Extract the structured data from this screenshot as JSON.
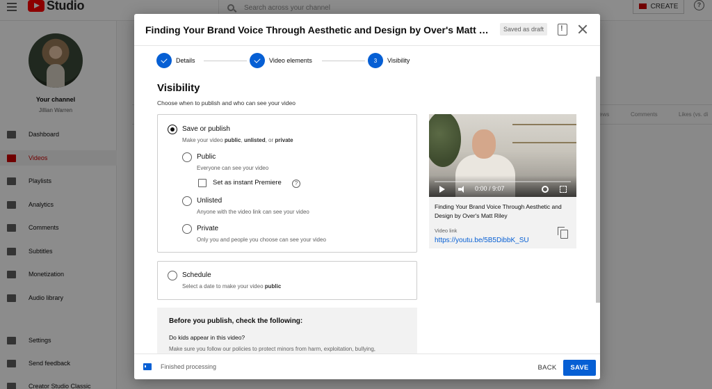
{
  "topbar": {
    "logo_text": "Studio",
    "search_placeholder": "Search across your channel",
    "create_label": "CREATE",
    "help_glyph": "?"
  },
  "sidebar": {
    "channel_label": "Your channel",
    "channel_name": "Jillian Warren",
    "items": [
      {
        "label": "Dashboard",
        "icon": "dashboard-icon"
      },
      {
        "label": "Videos",
        "icon": "videos-icon",
        "active": true
      },
      {
        "label": "Playlists",
        "icon": "playlists-icon"
      },
      {
        "label": "Analytics",
        "icon": "analytics-icon"
      },
      {
        "label": "Comments",
        "icon": "comments-icon"
      },
      {
        "label": "Subtitles",
        "icon": "subtitles-icon"
      },
      {
        "label": "Monetization",
        "icon": "monetization-icon"
      },
      {
        "label": "Audio library",
        "icon": "audio-library-icon"
      },
      {
        "label": "Settings",
        "icon": "settings-icon"
      },
      {
        "label": "Send feedback",
        "icon": "feedback-icon"
      },
      {
        "label": "Creator Studio Classic",
        "icon": "classic-icon"
      }
    ]
  },
  "background_table": {
    "columns": [
      "ews",
      "Comments",
      "Likes (vs. di"
    ]
  },
  "modal": {
    "title": "Finding Your Brand Voice Through Aesthetic and Design by Over's Matt Riley",
    "draft_badge": "Saved as draft",
    "steps": [
      {
        "label": "Details",
        "state": "done"
      },
      {
        "label": "Video elements",
        "state": "done"
      },
      {
        "label": "Visibility",
        "state": "current",
        "number": "3"
      }
    ],
    "visibility": {
      "title": "Visibility",
      "subtitle": "Choose when to publish and who can see your video",
      "save_or_publish": {
        "title": "Save or publish",
        "desc_prefix": "Make your video ",
        "desc_public": "public",
        "desc_sep1": ", ",
        "desc_unlisted": "unlisted",
        "desc_sep2": ", or ",
        "desc_private": "private"
      },
      "options": [
        {
          "title": "Public",
          "desc": "Everyone can see your video"
        },
        {
          "title": "Unlisted",
          "desc": "Anyone with the video link can see your video"
        },
        {
          "title": "Private",
          "desc": "Only you and people you choose can see your video"
        }
      ],
      "instant_premiere": "Set as instant Premiere",
      "schedule": {
        "title": "Schedule",
        "desc_prefix": "Select a date to make your video ",
        "desc_bold": "public"
      }
    },
    "checklist": {
      "title": "Before you publish, check the following:",
      "question": "Do kids appear in this video?",
      "desc": "Make sure you follow our policies to protect minors from harm, exploitation, bullying, and violations of labor law."
    },
    "preview": {
      "time": "0:00 / 9:07",
      "title": "Finding Your Brand Voice Through Aesthetic and Design by Over's Matt Riley",
      "link_label": "Video link",
      "link": "https://youtu.be/5B5DibbK_SU"
    },
    "footer": {
      "status": "Finished processing",
      "back_label": "BACK",
      "save_label": "SAVE"
    }
  },
  "colors": {
    "accent": "#065fd4",
    "brand_red": "#ff0000",
    "active_nav": "#cc0000"
  }
}
